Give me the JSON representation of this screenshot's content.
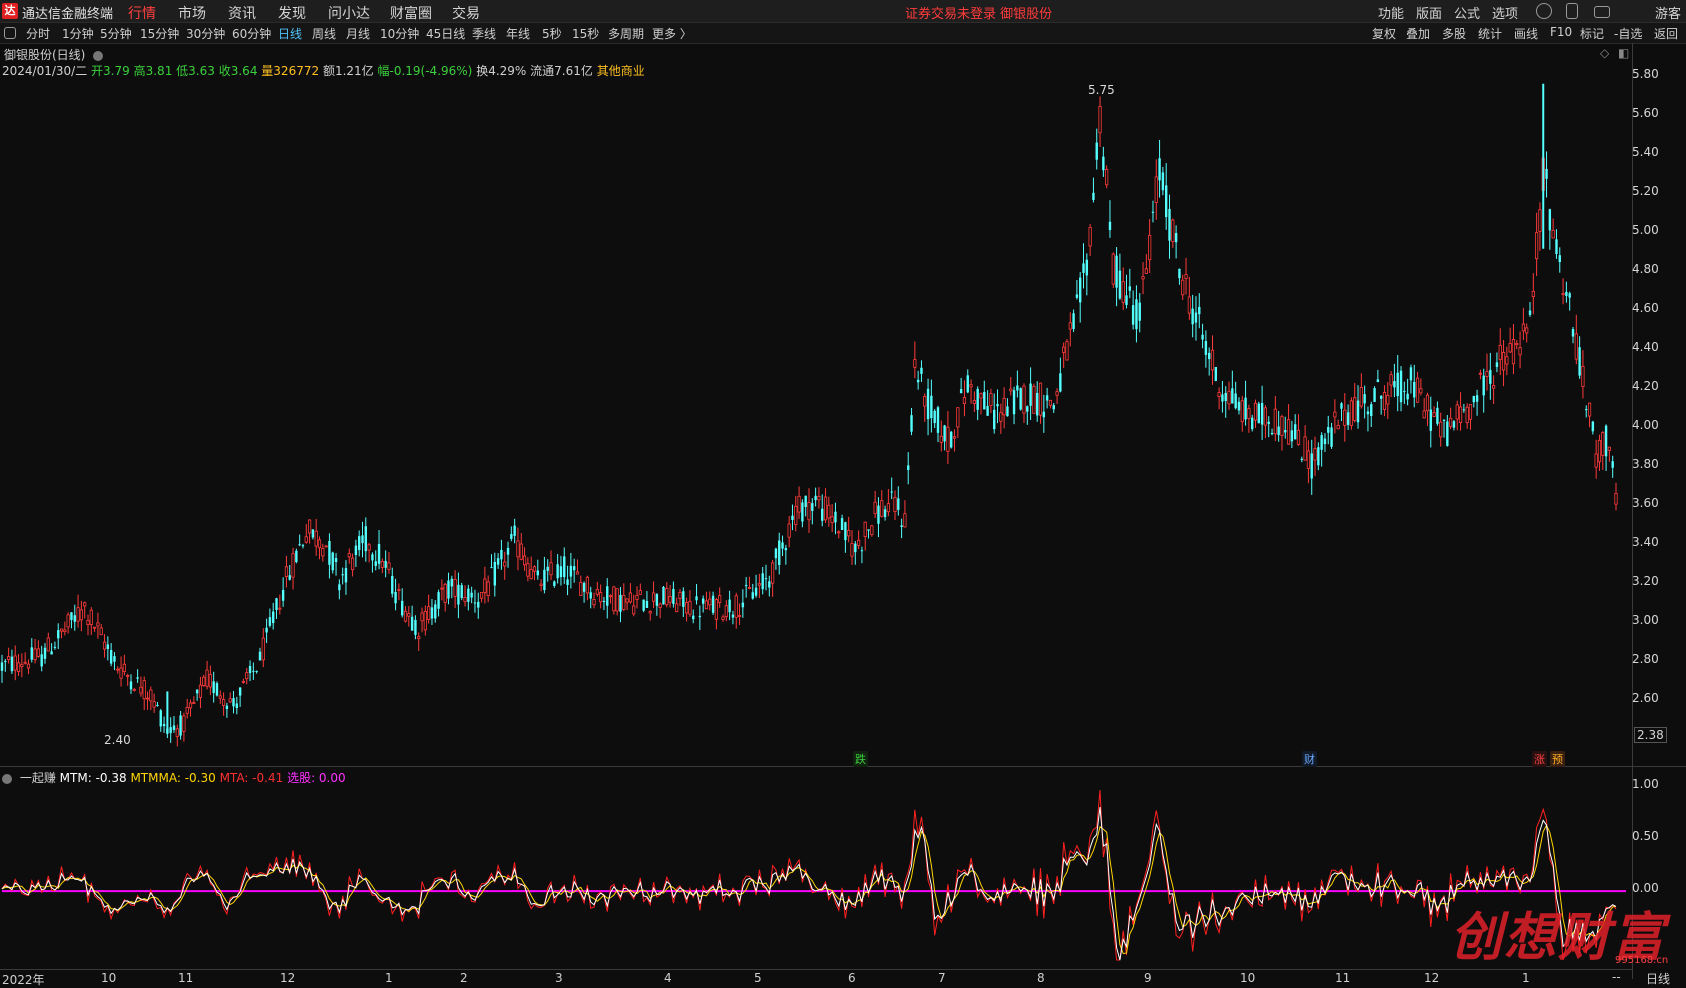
{
  "app": {
    "logo_text": "达",
    "name": "通达信金融终端"
  },
  "menu": [
    {
      "label": "行情",
      "active": true
    },
    {
      "label": "市场"
    },
    {
      "label": "资讯"
    },
    {
      "label": "发现"
    },
    {
      "label": "问小达"
    },
    {
      "label": "财富圈"
    },
    {
      "label": "交易"
    }
  ],
  "notice": "证券交易未登录  御银股份",
  "right_menu": [
    "功能",
    "版面",
    "公式",
    "选项",
    "游客"
  ],
  "periods": [
    "分时",
    "1分钟",
    "5分钟",
    "15分钟",
    "30分钟",
    "60分钟",
    "日线",
    "周线",
    "月线",
    "10分钟",
    "45日线",
    "季线",
    "年线",
    "5秒",
    "15秒",
    "多周期",
    "更多 〉"
  ],
  "active_period": "日线",
  "right_tools": [
    "复权",
    "叠加",
    "多股",
    "统计",
    "画线",
    "F10",
    "标记",
    "-自选",
    "返回"
  ],
  "chart_title": "御银股份(日线)",
  "info": {
    "date": "2024/01/30/二",
    "open": "开3.79",
    "high": "高3.81",
    "low": "低3.63",
    "close": "收3.64",
    "volume": "量326772",
    "amount": "额1.21亿",
    "change": "幅-0.19(-4.96%)",
    "turnover": "换4.29%",
    "float": "流通7.61亿",
    "sector": "其他商业"
  },
  "price_axis": [
    "5.80",
    "5.60",
    "5.40",
    "5.20",
    "5.00",
    "4.80",
    "4.60",
    "4.40",
    "4.20",
    "4.00",
    "3.80",
    "3.60",
    "3.40",
    "3.20",
    "3.00",
    "2.80",
    "2.60",
    "2.38"
  ],
  "annotations": {
    "high": "5.75",
    "low": "2.40"
  },
  "badges": {
    "b1": "跌",
    "b2": "财",
    "b3": "涨",
    "b4": "预"
  },
  "indicator": {
    "name": "一起赚",
    "mtm": "MTM: -0.38",
    "mtmma": "MTMMA: -0.30",
    "mta": "MTA: -0.41",
    "pick": "选股: 0.00"
  },
  "ind_axis": [
    "1.00",
    "0.50",
    "0.00"
  ],
  "x_labels": [
    "2022年",
    "10",
    "11",
    "12",
    "1",
    "2",
    "3",
    "4",
    "5",
    "6",
    "7",
    "8",
    "9",
    "10",
    "11",
    "12",
    "1"
  ],
  "bottom_right": {
    "dash": "--",
    "label": "日线"
  },
  "watermark": {
    "text": "创想财富",
    "url": "995168.cn"
  },
  "colors": {
    "up": "#ff3a3a",
    "down": "#54ffff",
    "mtm": "#ffffff",
    "mtmma": "#ffd700",
    "mta": "#ff2020",
    "pick": "#ff00ff"
  },
  "chart_data": {
    "type": "candlestick",
    "title": "御银股份(日线)",
    "y_range": [
      2.38,
      5.8
    ],
    "high_point": 5.75,
    "low_point": 2.4,
    "last_close": 3.64,
    "anchors": [
      [
        0,
        2.75
      ],
      [
        12,
        2.8
      ],
      [
        25,
        3.05
      ],
      [
        35,
        2.75
      ],
      [
        45,
        2.6
      ],
      [
        50,
        2.42
      ],
      [
        55,
        2.45
      ],
      [
        62,
        2.68
      ],
      [
        70,
        2.55
      ],
      [
        78,
        2.78
      ],
      [
        85,
        3.15
      ],
      [
        92,
        3.45
      ],
      [
        98,
        3.38
      ],
      [
        102,
        3.2
      ],
      [
        110,
        3.4
      ],
      [
        115,
        3.3
      ],
      [
        120,
        3.1
      ],
      [
        126,
        2.95
      ],
      [
        135,
        3.15
      ],
      [
        145,
        3.1
      ],
      [
        155,
        3.4
      ],
      [
        162,
        3.18
      ],
      [
        170,
        3.25
      ],
      [
        180,
        3.12
      ],
      [
        190,
        3.08
      ],
      [
        200,
        3.1
      ],
      [
        210,
        3.05
      ],
      [
        222,
        3.06
      ],
      [
        232,
        3.2
      ],
      [
        240,
        3.55
      ],
      [
        246,
        3.6
      ],
      [
        252,
        3.5
      ],
      [
        258,
        3.35
      ],
      [
        265,
        3.55
      ],
      [
        270,
        3.58
      ],
      [
        273,
        3.5
      ],
      [
        276,
        4.3
      ],
      [
        280,
        4.1
      ],
      [
        286,
        3.9
      ],
      [
        292,
        4.2
      ],
      [
        300,
        4.05
      ],
      [
        310,
        4.15
      ],
      [
        318,
        4.1
      ],
      [
        324,
        4.5
      ],
      [
        328,
        4.8
      ],
      [
        332,
        5.6
      ],
      [
        336,
        4.8
      ],
      [
        344,
        4.55
      ],
      [
        350,
        5.3
      ],
      [
        356,
        4.8
      ],
      [
        362,
        4.5
      ],
      [
        368,
        4.2
      ],
      [
        376,
        4.05
      ],
      [
        388,
        4.0
      ],
      [
        396,
        3.8
      ],
      [
        406,
        4.05
      ],
      [
        416,
        4.15
      ],
      [
        426,
        4.2
      ],
      [
        436,
        3.95
      ],
      [
        444,
        4.1
      ],
      [
        452,
        4.3
      ],
      [
        458,
        4.4
      ],
      [
        462,
        4.5
      ],
      [
        466,
        5.3
      ],
      [
        470,
        4.9
      ],
      [
        474,
        4.6
      ],
      [
        478,
        4.2
      ],
      [
        482,
        3.85
      ],
      [
        486,
        3.92
      ],
      [
        488,
        3.64
      ]
    ],
    "n_days": 489,
    "indicator": {
      "name": "一起赚",
      "MTM": -0.38,
      "MTMMA": -0.3,
      "MTA": -0.41,
      "选股": 0.0,
      "y_range": [
        -0.75,
        1.1
      ]
    }
  }
}
